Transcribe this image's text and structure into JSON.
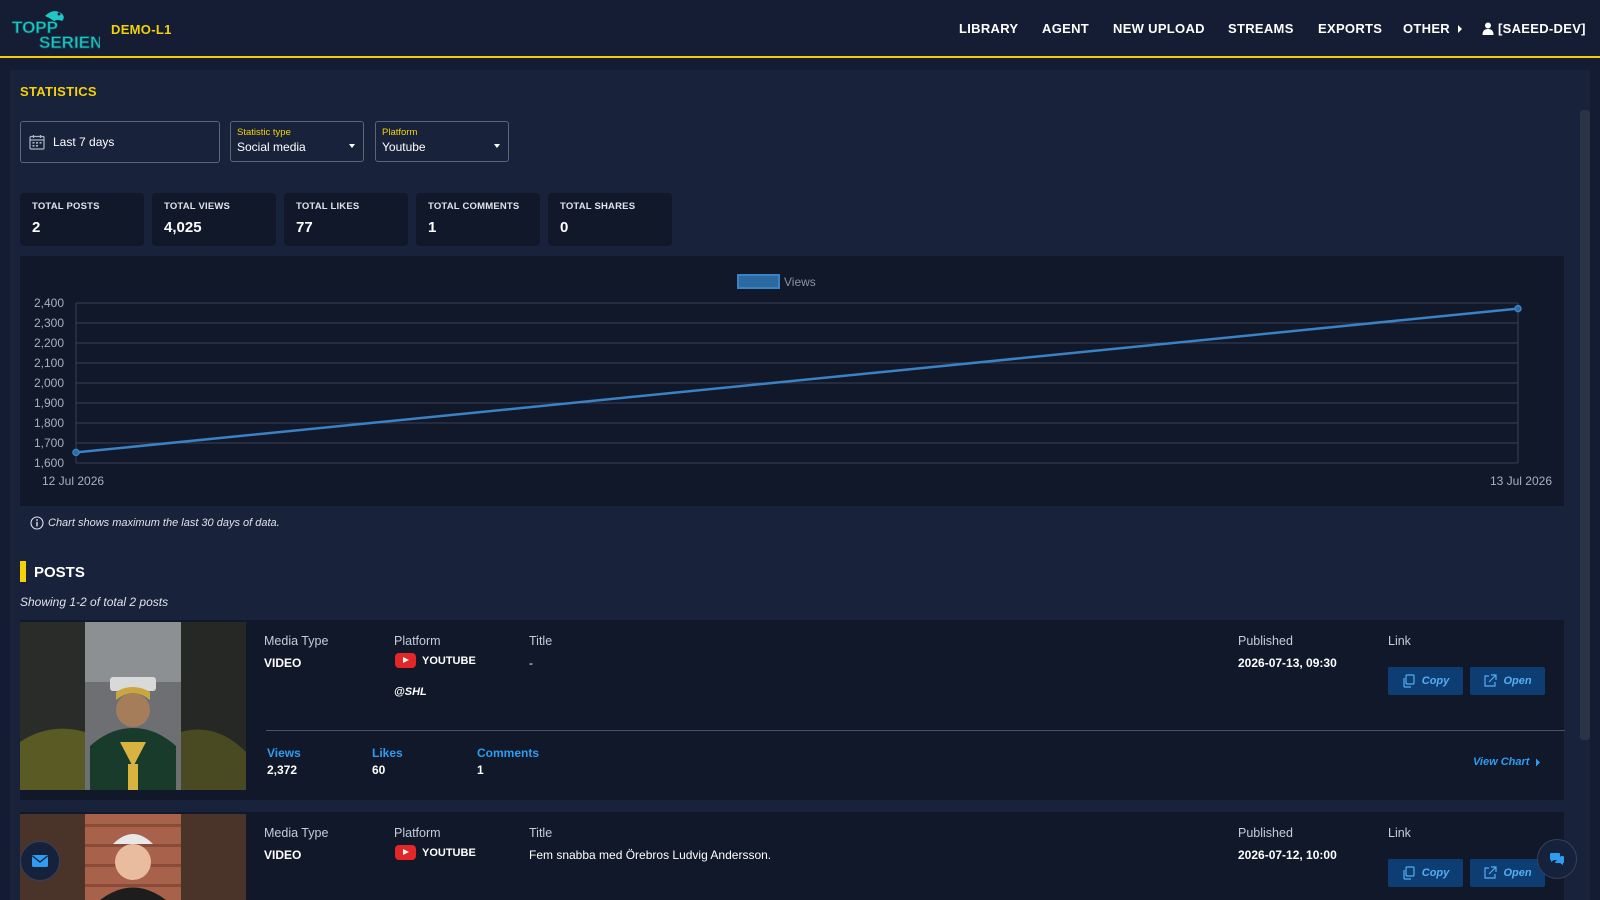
{
  "header": {
    "app_name": "DEMO-L1",
    "logo_text_1": "TOPP",
    "logo_text_2": "SERIEN",
    "nav": {
      "library": "LIBRARY",
      "agent": "AGENT",
      "new_upload": "NEW UPLOAD",
      "streams": "STREAMS",
      "exports": "EXPORTS",
      "other": "OTHER",
      "user": "[SAEED-DEV]"
    },
    "icons": {
      "other": "caret-right-icon",
      "user": "user-icon"
    }
  },
  "statistics": {
    "title": "STATISTICS",
    "date_range": "Last 7 days",
    "statistic_type": {
      "label": "Statistic type",
      "value": "Social media"
    },
    "platform": {
      "label": "Platform",
      "value": "Youtube"
    },
    "totals": {
      "posts": {
        "label": "TOTAL POSTS",
        "value": "2"
      },
      "views": {
        "label": "TOTAL VIEWS",
        "value": "4,025"
      },
      "likes": {
        "label": "TOTAL LIKES",
        "value": "77"
      },
      "comments": {
        "label": "TOTAL COMMENTS",
        "value": "1"
      },
      "shares": {
        "label": "TOTAL SHARES",
        "value": "0"
      }
    },
    "chart_note": "Chart shows maximum the last 30 days of data."
  },
  "chart_data": {
    "type": "line",
    "x": [
      "12 Jul 2026",
      "13 Jul 2026"
    ],
    "series": [
      {
        "name": "Views",
        "values": [
          1653,
          2372
        ],
        "color": "#3b82c4"
      }
    ],
    "title": "",
    "xlabel": "",
    "ylabel": "",
    "ylim": [
      1600,
      2400
    ],
    "yticks": [
      "2,400",
      "2,300",
      "2,200",
      "2,100",
      "2,000",
      "1,900",
      "1,800",
      "1,700",
      "1,600"
    ],
    "legend": "top-center",
    "grid": true
  },
  "posts": {
    "title": "POSTS",
    "showing": "Showing 1-2 of total 2 posts",
    "labels": {
      "media_type": "Media Type",
      "platform": "Platform",
      "title": "Title",
      "published": "Published",
      "link": "Link",
      "copy": "Copy",
      "open": "Open",
      "views": "Views",
      "likes": "Likes",
      "comments": "Comments",
      "view_chart": "View Chart"
    },
    "items": [
      {
        "media_type": "VIDEO",
        "platform": "YOUTUBE",
        "channel": "@SHL",
        "title": "-",
        "published": "2026-07-13, 09:30",
        "views": "2,372",
        "likes": "60",
        "comments": "1"
      },
      {
        "media_type": "VIDEO",
        "platform": "YOUTUBE",
        "title": "Fem snabba med Örebros Ludvig Andersson.",
        "published": "2026-07-12, 10:00"
      }
    ]
  },
  "colors": {
    "accent": "#f5d10a",
    "link_blue": "#2f9cf0",
    "background": "#131c33"
  }
}
